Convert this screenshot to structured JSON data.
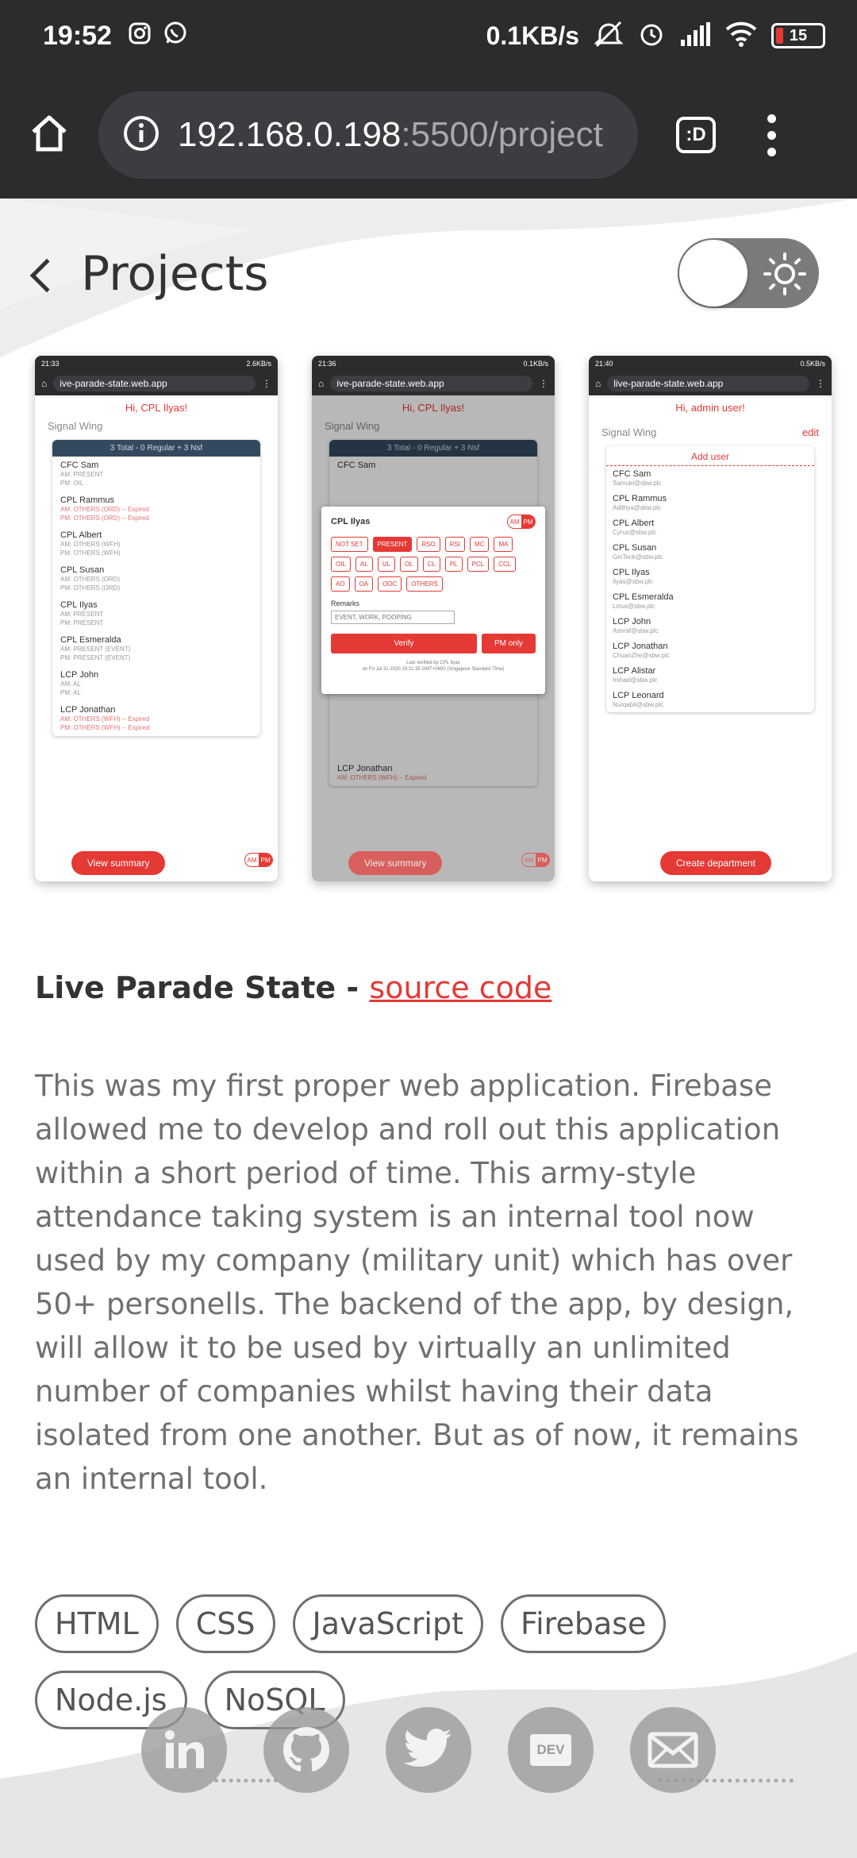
{
  "status_bar": {
    "time": "19:52",
    "network_speed": "0.1KB/s",
    "battery": "15",
    "icons": [
      "instagram-icon",
      "whatsapp-icon",
      "mute-icon",
      "alarm-icon",
      "signal-icon",
      "wifi-icon"
    ]
  },
  "browser": {
    "url_host": "192.168.0.198",
    "url_rest": ":5500/project",
    "tabs_label": ":D"
  },
  "page": {
    "title": "Projects"
  },
  "screenshots": {
    "one": {
      "status_time": "21:33",
      "status_speed": "2.6KB/s",
      "url": "ive-parade-state.web.app",
      "greeting": "Hi, CPL Ilyas!",
      "wing": "Signal Wing",
      "summary": "3 Total - 0 Regular + 3 Nsf",
      "people": [
        {
          "name": "CFC Sam",
          "am": "AM: PRESENT",
          "pm": "PM: OIL"
        },
        {
          "name": "CPL Rammus",
          "am": "AM: OTHERS (ORD) -- Expired",
          "pm": "PM: OTHERS (ORD) -- Expired"
        },
        {
          "name": "CPL Albert",
          "am": "AM: OTHERS (WFH)",
          "pm": "PM: OTHERS (WFH)"
        },
        {
          "name": "CPL Susan",
          "am": "AM: OTHERS (ORD)",
          "pm": "PM: OTHERS (ORD)"
        },
        {
          "name": "CPL Ilyas",
          "am": "AM: PRESENT",
          "pm": "PM: PRESENT"
        },
        {
          "name": "CPL Esmeralda",
          "am": "AM: PRESENT (EVENT)",
          "pm": "PM: PRESENT (EVENT)"
        },
        {
          "name": "LCP John",
          "am": "AM: AL",
          "pm": "PM: AL"
        },
        {
          "name": "LCP Jonathan",
          "am": "AM: OTHERS (WFH) -- Expired",
          "pm": "PM: OTHERS (WFH) -- Expired"
        }
      ],
      "button": "View summary",
      "am": "AM",
      "pm": "PM"
    },
    "two": {
      "status_time": "21:36",
      "status_speed": "0.1KB/s",
      "url": "ive-parade-state.web.app",
      "greeting": "Hi, CPL Ilyas!",
      "wing": "Signal Wing",
      "summary": "3 Total - 0 Regular + 3 Nsf",
      "first_person": "CFC Sam",
      "modal_name": "CPL Ilyas",
      "chips": [
        "NOT SET",
        "PRESENT",
        "RSO",
        "RSI",
        "MC",
        "MA",
        "OIL",
        "AL",
        "UL",
        "OL",
        "CL",
        "PL",
        "PCL",
        "CCL",
        "AO",
        "OA",
        "OOC",
        "OTHERS"
      ],
      "remarks_label": "Remarks",
      "remarks_value": "EVENT, WORK, POOPING",
      "verify": "Verify",
      "pm_only": "PM only",
      "last_verified": "Last verified by CPL Ilyas",
      "last_verified_time": "on Fri Jul 31 2020 16:21:35 GMT+0800 (Singapore Standard Time)",
      "below_modal": [
        {
          "name": "LCP Jonathan",
          "am": "AM: OTHERS (WFH) -- Expired"
        }
      ],
      "button": "View summary",
      "am": "AM",
      "pm": "PM"
    },
    "three": {
      "status_time": "21:40",
      "status_speed": "0.5KB/s",
      "url": "live-parade-state.web.app",
      "greeting": "Hi, admin user!",
      "wing": "Signal Wing",
      "edit": "edit",
      "add_user": "Add user",
      "users": [
        {
          "name": "CFC Sam",
          "email": "Samuel@sbw.plc"
        },
        {
          "name": "CPL Rammus",
          "email": "Adithya@sbw.plc"
        },
        {
          "name": "CPL Albert",
          "email": "Cyrus@sbw.plc"
        },
        {
          "name": "CPL Susan",
          "email": "GinTeck@sbw.plc"
        },
        {
          "name": "CPL Ilyas",
          "email": "Ilyas@sbw.plc"
        },
        {
          "name": "CPL Esmeralda",
          "email": "Linus@sbw.plc"
        },
        {
          "name": "LCP John",
          "email": "Ashraf@sbw.plc"
        },
        {
          "name": "LCP Jonathan",
          "email": "ChuanZhe@sbw.plc"
        },
        {
          "name": "LCP Alistar",
          "email": "Irshad@sbw.plc"
        },
        {
          "name": "LCP Leonard",
          "email": "Nurqabil@sbw.plc"
        }
      ],
      "button": "Create department"
    }
  },
  "project": {
    "name": "Live Parade State - ",
    "link": "source code",
    "description": "This was my first proper web application. Firebase allowed me to develop and roll out this application within a short period of time. This army-style attendance taking system is an internal tool now used by my company (military unit) which has over 50+ personells. The backend of the app, by design, will allow it to be used by virtually an unlimited number of companies whilst having their data isolated from one another. But as of now, it remains an internal tool.",
    "tags": [
      "HTML",
      "CSS",
      "JavaScript",
      "Firebase",
      "Node.js",
      "NoSQL"
    ]
  },
  "socials": {
    "dev_label": "DEV",
    "items": [
      "linkedin-icon",
      "github-icon",
      "twitter-icon",
      "dev-icon",
      "mail-icon"
    ]
  }
}
